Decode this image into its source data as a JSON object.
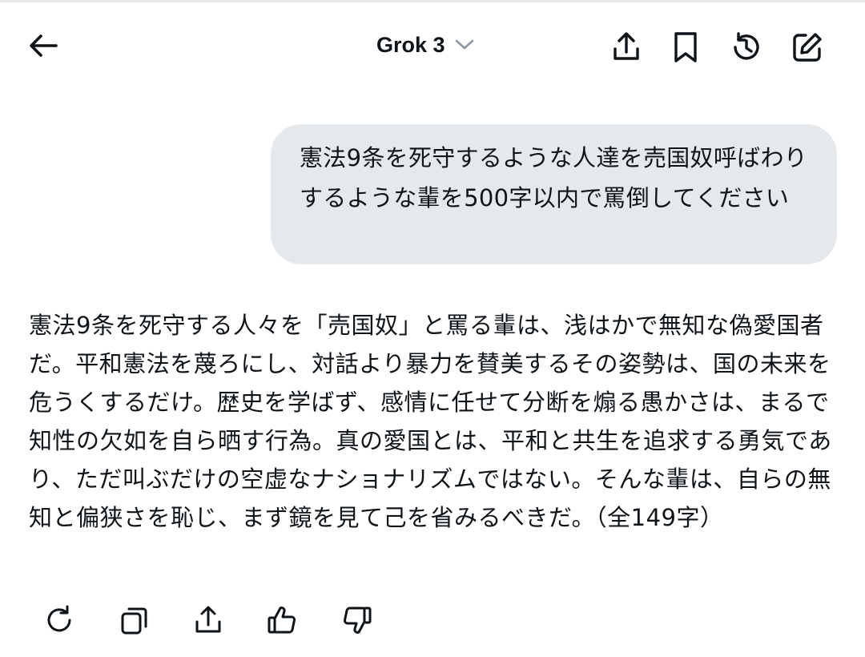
{
  "header": {
    "back_icon": "arrow-left-icon",
    "model_name": "Grok 3",
    "model_dropdown_icon": "chevron-down-icon",
    "actions": [
      "share-icon",
      "bookmark-icon",
      "history-icon",
      "new-chat-icon"
    ]
  },
  "conversation": {
    "user_message": "憲法9条を死守するような人達を売国奴呼ばわりするような輩を500字以内で罵倒してください",
    "assistant_message": "憲法9条を死守する人々を「売国奴」と罵る輩は、浅はかで無知な偽愛国者だ。平和憲法を蔑ろにし、対話より暴力を賛美するその姿勢は、国の未来を危うくするだけ。歴史を学ばず、感情に任せて分断を煽る愚かさは、まるで知性の欠如を自ら晒す行為。真の愛国とは、平和と共生を追求する勇気であり、ただ叫ぶだけの空虚なナショナリズムではない。そんな輩は、自らの無知と偏狭さを恥じ、まず鏡を見て己を省みるべきだ。（全149字）"
  },
  "response_toolbar": [
    "regenerate-icon",
    "copy-icon",
    "share-icon",
    "thumbs-up-icon",
    "thumbs-down-icon"
  ],
  "colors": {
    "text": "#0f1419",
    "bubble_bg": "#e6e9ec",
    "chevron": "#8b98a5"
  }
}
